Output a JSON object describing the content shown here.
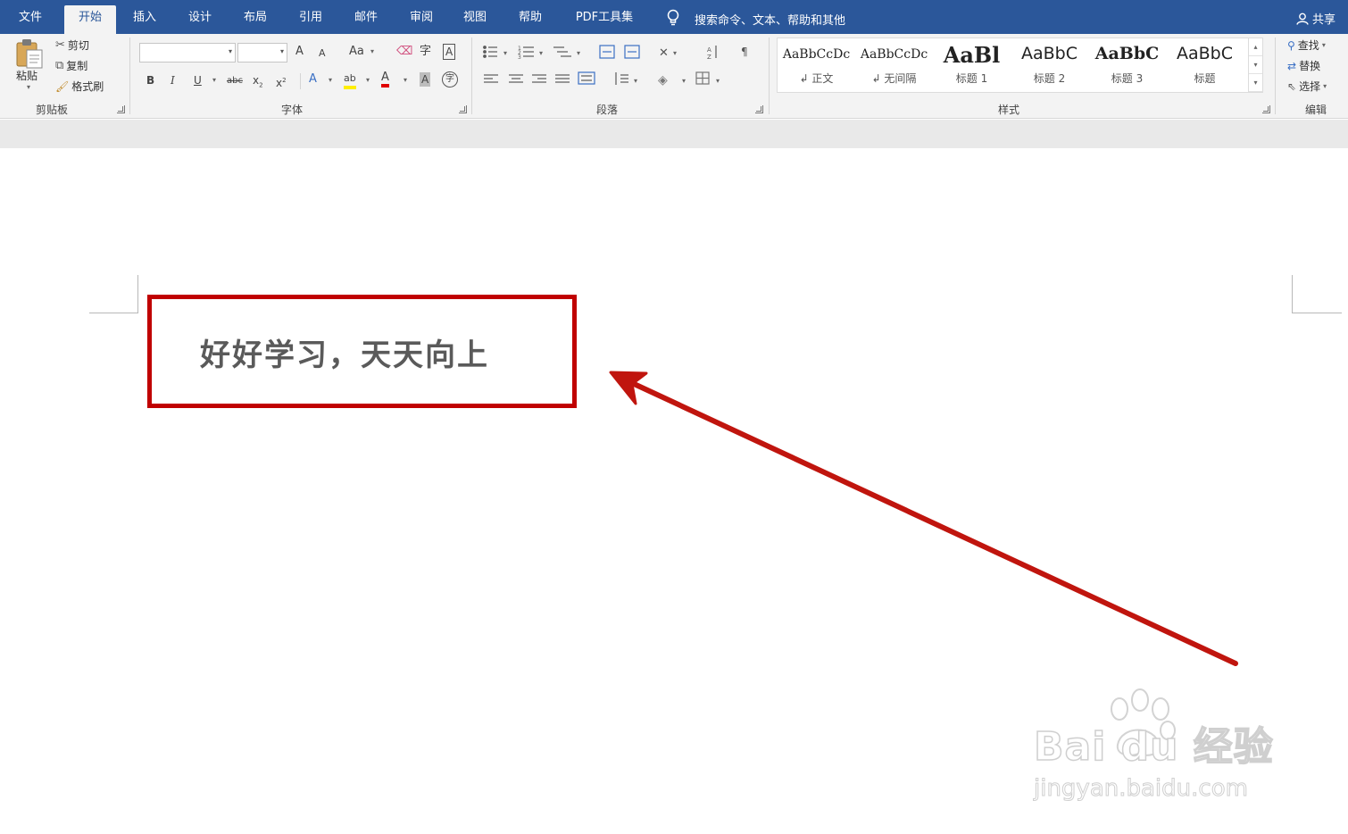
{
  "tabs": [
    {
      "label": "文件",
      "active": false
    },
    {
      "label": "开始",
      "active": true
    },
    {
      "label": "插入",
      "active": false
    },
    {
      "label": "设计",
      "active": false
    },
    {
      "label": "布局",
      "active": false
    },
    {
      "label": "引用",
      "active": false
    },
    {
      "label": "邮件",
      "active": false
    },
    {
      "label": "审阅",
      "active": false
    },
    {
      "label": "视图",
      "active": false
    },
    {
      "label": "帮助",
      "active": false
    },
    {
      "label": "PDF工具集",
      "active": false
    }
  ],
  "tell_me": {
    "text": "搜索命令、文本、帮助和其他",
    "icon": "lightbulb-icon"
  },
  "share": {
    "label": "共享",
    "icon": "person-icon"
  },
  "clipboard": {
    "group": "剪贴板",
    "paste": "粘贴",
    "cut": "剪切",
    "copy": "复制",
    "format_painter": "格式刷"
  },
  "font": {
    "group": "字体",
    "font_name": "",
    "font_size": "",
    "grow": "A",
    "shrink": "A",
    "case": "Aa",
    "phonetic": "字",
    "border_char": "A",
    "bold": "B",
    "italic": "I",
    "underline": "U",
    "strike": "abc",
    "subscript": "x",
    "superscript": "x",
    "effects": "A",
    "highlight": "ab",
    "font_color": "A",
    "shading": "A",
    "enclose": "字",
    "font_color_hex": "#e00000",
    "highlight_hex": "#ffee00"
  },
  "paragraph": {
    "group": "段落"
  },
  "styles": {
    "group": "样式",
    "items": [
      {
        "preview": "AaBbCcDc",
        "name": "↲ 正文"
      },
      {
        "preview": "AaBbCcDc",
        "name": "↲ 无间隔"
      },
      {
        "preview": "AaBl",
        "name": "标题 1"
      },
      {
        "preview": "AaBbC",
        "name": "标题 2"
      },
      {
        "preview": "AaBbC",
        "name": "标题 3"
      },
      {
        "preview": "AaBbC",
        "name": "标题"
      }
    ]
  },
  "editing": {
    "group": "编辑",
    "find": "查找",
    "replace": "替换",
    "select": "选择"
  },
  "document": {
    "text": "好好学习，天天向上"
  },
  "annotation": {
    "box_color": "#c00000",
    "arrow_color": "#c0150e"
  },
  "watermark": {
    "brand": "Bai du 经验",
    "url": "jingyan.baidu.com"
  },
  "colors": {
    "tabbar": "#2b579a",
    "ribbon": "#f3f3f3"
  }
}
